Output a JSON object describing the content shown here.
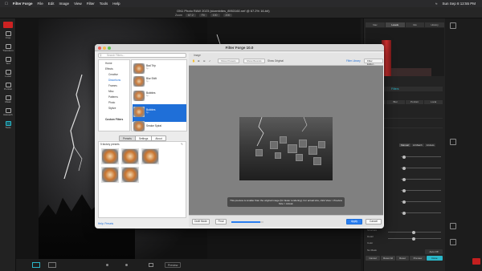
{
  "menubar": {
    "app": "Filter Forge",
    "items": [
      "File",
      "Edit",
      "Image",
      "View",
      "Filter",
      "Tools",
      "Help"
    ],
    "datetime": "Sun Sep 8  12:55 PM"
  },
  "titlebar": {
    "document": "ON1 Photo RAW 2023 (stormbites_8953160.nef @ 67.2% 16-bit)",
    "zoom_label": "Zoom",
    "zoom_value": "67.2",
    "fit": "Fit",
    "ratio1": "100",
    "ratio2": "200"
  },
  "left_tools": [
    "Crop",
    "Transform",
    "Text",
    "Local",
    "Portrait",
    "Mask",
    "Retouch",
    "Tools"
  ],
  "right_panel": {
    "tabs": [
      "Nav",
      "Levels",
      "Info",
      "History"
    ],
    "filters_label": "Filters",
    "subtabs": [
      "Presets",
      "Blur",
      "Portrait",
      "Local"
    ],
    "auto_buttons": [
      "Manual",
      "AI Match",
      "AI Auto"
    ],
    "bottom_labels": [
      "Structure",
      "Detail",
      "Color"
    ],
    "cancel": "Cancel",
    "reset_all": "Reset All",
    "reset": "Reset",
    "preview": "Preview",
    "done": "Done",
    "auto_off": "Auto Off",
    "no_mask": "No Mask"
  },
  "bottombar": {
    "preview_button": "Preview"
  },
  "dialog": {
    "title": "Filter Forge 10.0",
    "search_placeholder": "Search Filters...",
    "tree": [
      "Home",
      "Effects",
      "Creative",
      "Distortions",
      "Frames",
      "Misc",
      "Patterns",
      "Photo",
      "Stylize",
      "Custom Filters"
    ],
    "thumbs": [
      {
        "name": "Bad Trip",
        "author": "by..."
      },
      {
        "name": "Blur Shift",
        "author": "by..."
      },
      {
        "name": "Bubbles",
        "author": "by..."
      },
      {
        "name": "Bubbles",
        "author": "by..."
      },
      {
        "name": "Smoke Spiral",
        "author": "by..."
      }
    ],
    "left_tabs": [
      "Presets",
      "Settings",
      "About"
    ],
    "presets_label": "5 factory presets",
    "help_link": "Help: Presets",
    "image_label": "Image",
    "toolbar": {
      "show_presets": "Show Presets",
      "show_bounds": "Show Bounds",
      "show_original": "Show Original",
      "filter_library": "Filter Library",
      "filter_editor": "Filter Editor..."
    },
    "preview_note": "This preview is smaller than the original image (for faster rendering).\nFor actual size, click View > Preview Size > Actual.",
    "footer": {
      "draft_mode": "Draft Mode",
      "final": "Final",
      "progress": 0.9,
      "apply": "Apply",
      "cancel": "Cancel"
    }
  },
  "colors": {
    "accent": "#2a7ef0",
    "selection": "#1f6fd8",
    "histogram_red": "#d43030",
    "tool_active": "#2ab7c9"
  }
}
